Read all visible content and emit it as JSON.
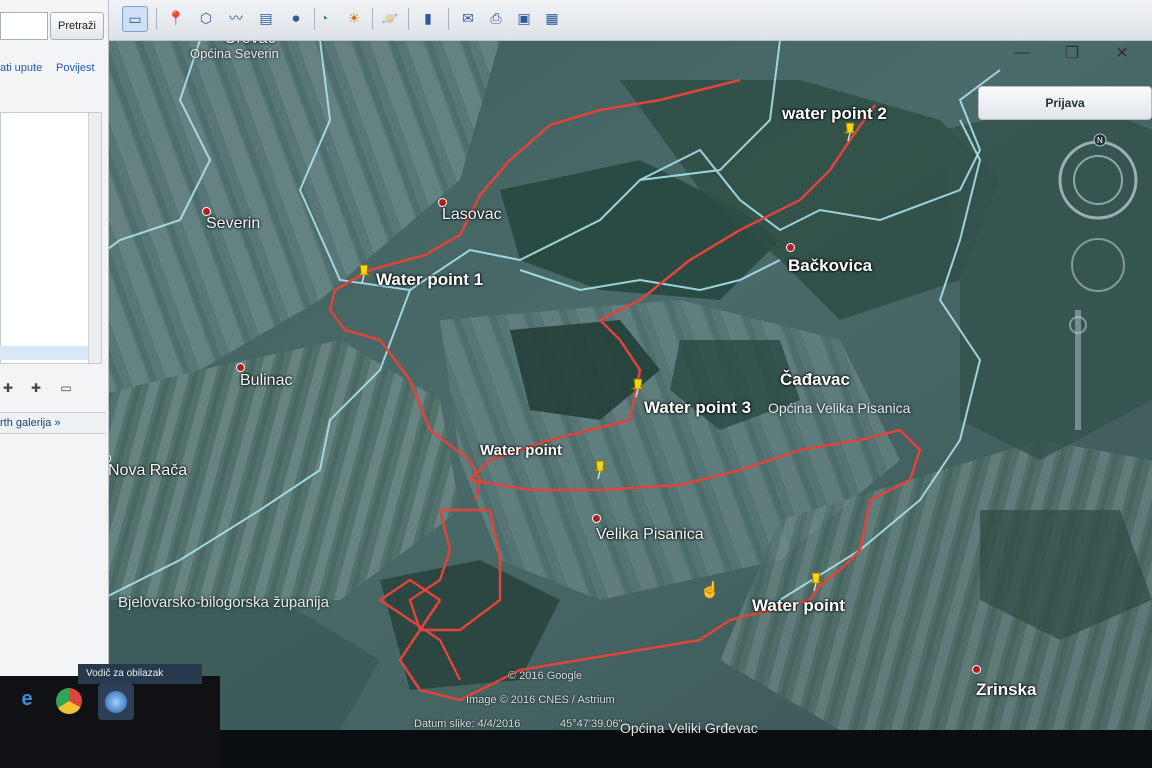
{
  "toolbar": {
    "icons": [
      "sidebar-toggle",
      "placemark",
      "polygon",
      "path",
      "image-overlay",
      "record-tour",
      "historical-imagery",
      "sun",
      "planets",
      "ruler",
      "email",
      "print",
      "save-image",
      "maps-view"
    ]
  },
  "window": {
    "minimize": "—",
    "maximize": "❐",
    "close": "✕"
  },
  "sidebar": {
    "search_button": "Pretraži",
    "link_directions": "ati upute",
    "link_history": "Povijest",
    "gallery_label": "rth galerija »"
  },
  "header": {
    "login_button": "Prijava"
  },
  "map": {
    "places": {
      "orovac": "Orovac",
      "opcina_severin": "Općina Severin",
      "severin": "Severin",
      "lasovac": "Lasovac",
      "backovica": "Bačkovica",
      "bulinac": "Bulinac",
      "cadavac": "Čađavac",
      "opcina_velika_pisanica": "Općina Velika Pisanica",
      "nova_raca": "Nova Rača",
      "velika_pisanica": "Velika Pisanica",
      "zupanija": "Bjelovarsko-bilogorska županija",
      "zrinska": "Zrinska",
      "opcina_veliki_grdevac": "Općina Veliki Grđevac"
    },
    "waypoints": {
      "wp2": "water point 2",
      "wp1": "Water point 1",
      "wp3": "Water point 3",
      "wp_center": "Water point",
      "wp_south": "Water point"
    },
    "attribution": {
      "copyright": "© 2016 Google",
      "image": "Image © 2016 CNES / Astrium",
      "date": "Datum slike: 4/4/2016",
      "coords": "45°47'39.06\""
    },
    "colors": {
      "route": "#e0443a",
      "border": "#a9e3ea",
      "pin": "#f5d515"
    }
  },
  "taskbar": {
    "guide_label": "Vodič za obilazak"
  }
}
